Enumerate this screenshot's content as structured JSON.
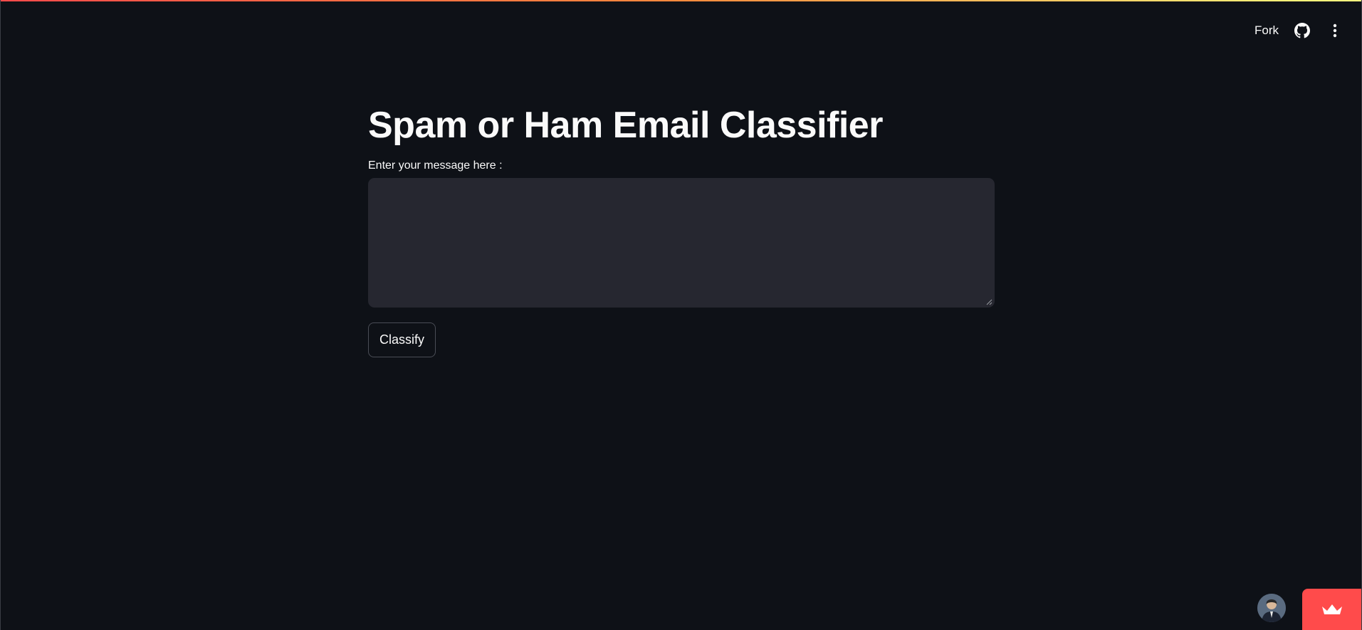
{
  "header": {
    "fork_label": "Fork",
    "github_icon": "github-icon",
    "menu_icon": "kebab-menu-icon"
  },
  "main": {
    "title": "Spam or Ham Email Classifier",
    "input_label": "Enter your message here :",
    "input_value": "",
    "button_label": "Classify"
  },
  "footer": {
    "avatar_icon": "user-avatar",
    "badge_icon": "crown-icon"
  },
  "colors": {
    "background": "#0e1117",
    "input_background": "#262730",
    "accent": "#ff4b4b",
    "text": "#fafafa"
  }
}
